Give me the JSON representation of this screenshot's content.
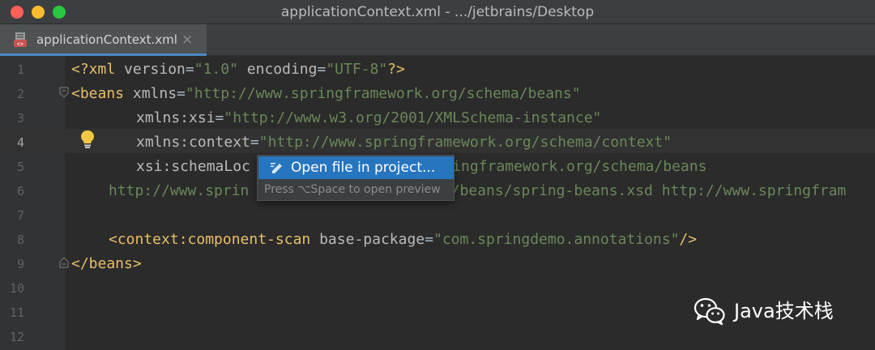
{
  "window": {
    "title": "applicationContext.xml - .../jetbrains/Desktop"
  },
  "tabs": [
    {
      "label": "applicationContext.xml",
      "close_glyph": "×",
      "icon": "xml-file-icon",
      "active": true
    }
  ],
  "editor": {
    "line_numbers": [
      "1",
      "2",
      "3",
      "4",
      "5",
      "6",
      "7",
      "8",
      "9",
      "10",
      "11",
      "12"
    ],
    "current_line": 4,
    "lines": [
      [
        {
          "t": "pi",
          "v": "<?xml "
        },
        {
          "t": "attr",
          "v": "version"
        },
        {
          "t": "plain",
          "v": "="
        },
        {
          "t": "str",
          "v": "\"1.0\""
        },
        {
          "t": "plain",
          "v": " "
        },
        {
          "t": "attr",
          "v": "encoding"
        },
        {
          "t": "plain",
          "v": "="
        },
        {
          "t": "str",
          "v": "\"UTF-8\""
        },
        {
          "t": "pi",
          "v": "?>"
        }
      ],
      [
        {
          "t": "tag",
          "v": "<beans "
        },
        {
          "t": "attr",
          "v": "xmlns"
        },
        {
          "t": "plain",
          "v": "="
        },
        {
          "t": "str",
          "v": "\"http://www.springframework.org/schema/beans\""
        }
      ],
      [
        {
          "t": "attr",
          "v": "xmlns:xsi"
        },
        {
          "t": "plain",
          "v": "="
        },
        {
          "t": "str",
          "v": "\"http://www.w3.org/2001/XMLSchema-instance\""
        }
      ],
      [
        {
          "t": "attr",
          "v": "xmlns:context"
        },
        {
          "t": "plain",
          "v": "="
        },
        {
          "t": "str",
          "v": "\"http://www.springframework.org/schema/context\""
        }
      ],
      [
        {
          "t": "attr",
          "v": "xsi:schemaLoc"
        },
        {
          "t": "plain",
          "v": "                       "
        },
        {
          "t": "str",
          "v": "ingframework.org/schema/beans"
        }
      ],
      [
        {
          "t": "str",
          "v": "http://www.sprin"
        },
        {
          "t": "plain",
          "v": "                       "
        },
        {
          "t": "str",
          "v": "/beans/spring-beans.xsd http://www.springfram"
        }
      ],
      [],
      [
        {
          "t": "tag",
          "v": "<context:component-scan "
        },
        {
          "t": "attr",
          "v": "base-package"
        },
        {
          "t": "plain",
          "v": "="
        },
        {
          "t": "str",
          "v": "\"com.springdemo.annotations\""
        },
        {
          "t": "tag",
          "v": "/>"
        }
      ],
      [
        {
          "t": "tag",
          "v": "</beans>"
        }
      ],
      [],
      [],
      []
    ]
  },
  "popup": {
    "item_label": "Open file in project...",
    "item_icon": "edit-pencil-icon",
    "hint": "Press ⌥Space to open preview"
  },
  "watermark": {
    "text": "Java技术栈",
    "icon": "wechat-icon"
  },
  "colors": {
    "background": "#2b2b2b",
    "gutter": "#313335",
    "tag": "#e8bf6a",
    "attribute": "#bababa",
    "string": "#6a8759",
    "selection": "#2675bf",
    "bulb": "#f0c844"
  }
}
